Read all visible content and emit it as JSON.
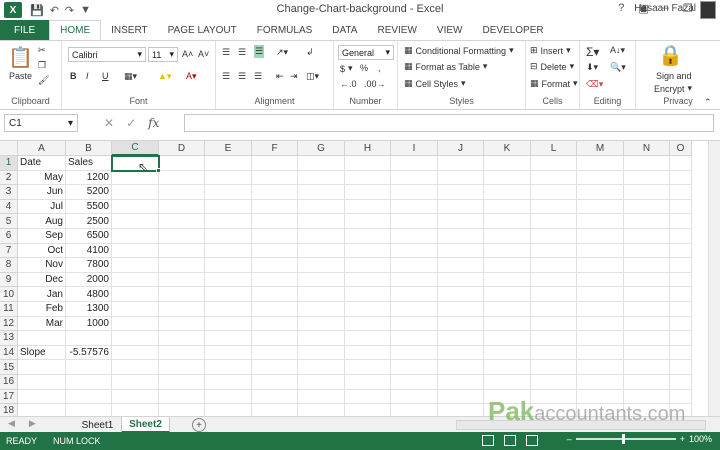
{
  "window": {
    "title": "Change-Chart-background - Excel",
    "user": "Hasaan Fazal",
    "app_logo": "X"
  },
  "qat": {
    "save_icon": "floppy-disk-icon",
    "undo_icon": "undo-icon",
    "redo_icon": "redo-icon"
  },
  "tabs": [
    "FILE",
    "HOME",
    "INSERT",
    "PAGE LAYOUT",
    "FORMULAS",
    "DATA",
    "REVIEW",
    "VIEW",
    "DEVELOPER"
  ],
  "ribbon": {
    "clipboard": {
      "label": "Clipboard",
      "paste": "Paste"
    },
    "font": {
      "label": "Font",
      "font_name": "Calibri",
      "font_size": "11",
      "bold": "B",
      "italic": "I",
      "underline": "U"
    },
    "alignment": {
      "label": "Alignment"
    },
    "number": {
      "label": "Number",
      "format": "General",
      "currency": "$",
      "percent": "%",
      "comma": ","
    },
    "styles": {
      "label": "Styles",
      "conditional": "Conditional Formatting",
      "format_table": "Format as Table",
      "cell_styles": "Cell Styles"
    },
    "cells": {
      "label": "Cells",
      "insert": "Insert",
      "delete": "Delete",
      "format": "Format"
    },
    "editing": {
      "label": "Editing"
    },
    "privacy": {
      "label": "Privacy",
      "sign1": "Sign and",
      "sign2": "Encrypt"
    }
  },
  "formula_bar": {
    "name_box": "C1",
    "fx": "fx",
    "value": ""
  },
  "columns": [
    "A",
    "B",
    "C",
    "D",
    "E",
    "F",
    "G",
    "H",
    "I",
    "J",
    "K",
    "L",
    "M",
    "N",
    "O"
  ],
  "rows": [
    "1",
    "2",
    "3",
    "4",
    "5",
    "6",
    "7",
    "8",
    "9",
    "10",
    "11",
    "12",
    "13",
    "14",
    "15",
    "16",
    "17",
    "18"
  ],
  "cells": {
    "A1": "Date",
    "B1": "Sales",
    "A2": "May",
    "B2": "1200",
    "A3": "Jun",
    "B3": "5200",
    "A4": "Jul",
    "B4": "5500",
    "A5": "Aug",
    "B5": "2500",
    "A6": "Sep",
    "B6": "6500",
    "A7": "Oct",
    "B7": "4100",
    "A8": "Nov",
    "B8": "7800",
    "A9": "Dec",
    "B9": "2000",
    "A10": "Jan",
    "B10": "4800",
    "A11": "Feb",
    "B11": "1300",
    "A12": "Mar",
    "B12": "1000",
    "A14": "Slope",
    "B14": "-5.57576"
  },
  "sheets": [
    "Sheet1",
    "Sheet2"
  ],
  "active_sheet": "Sheet2",
  "status": {
    "ready": "READY",
    "num_lock": "NUM LOCK",
    "zoom": "100%"
  },
  "watermark": {
    "main": "Pak",
    "sub": "accountants.com"
  },
  "colors": {
    "accent": "#217346"
  }
}
